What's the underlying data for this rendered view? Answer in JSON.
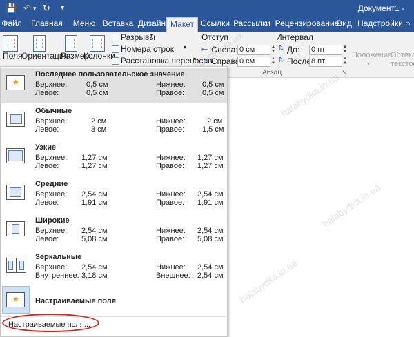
{
  "titlebar": {
    "title": "Документ1 -"
  },
  "tabs": [
    "Файл",
    "Главная",
    "Меню",
    "Вставка",
    "Дизайн",
    "Макет",
    "Ссылки",
    "Рассылки",
    "Рецензирование",
    "Вид",
    "Надстройки"
  ],
  "active_tab": "Макет",
  "ribbon": {
    "margins_label": "Поля",
    "orientation_label": "Ориентация",
    "size_label": "Размер",
    "columns_label": "Колонки",
    "breaks_label": "Разрывы",
    "line_numbers_label": "Номера строк",
    "hyphenation_label": "Расстановка переносов",
    "indent_header": "Отступ",
    "indent_left_label": "Слева:",
    "indent_left_value": "0 см",
    "indent_right_label": "Справа:",
    "indent_right_value": "0 см",
    "spacing_header": "Интервал",
    "spacing_before_label": "До:",
    "spacing_before_value": "0 пт",
    "spacing_after_label": "После:",
    "spacing_after_value": "8 пт",
    "paragraph_group": "Абзац",
    "position_label": "Положение",
    "wrap_label": "Обтекание текстом"
  },
  "presets": [
    {
      "title": "Последнее пользовательское значение",
      "top_label": "Верхнее:",
      "top": "0,5 см",
      "left_label": "Левое:",
      "left": "0,5 см",
      "bottom_label": "Нижнее:",
      "bottom": "0,5 см",
      "right_label": "Правое:",
      "right": "0,5 см"
    },
    {
      "title": "Обычные",
      "top_label": "Верхнее:",
      "top": "2 см",
      "left_label": "Левое:",
      "left": "3 см",
      "bottom_label": "Нижнее:",
      "bottom": "2 см",
      "right_label": "Правое:",
      "right": "1,5 см"
    },
    {
      "title": "Узкие",
      "top_label": "Верхнее:",
      "top": "1,27 см",
      "left_label": "Левое:",
      "left": "1,27 см",
      "bottom_label": "Нижнее:",
      "bottom": "1,27 см",
      "right_label": "Правое:",
      "right": "1,27 см"
    },
    {
      "title": "Средние",
      "top_label": "Верхнее:",
      "top": "2,54 см",
      "left_label": "Левое:",
      "left": "1,91 см",
      "bottom_label": "Нижнее:",
      "bottom": "2,54 см",
      "right_label": "Правое:",
      "right": "1,91 см"
    },
    {
      "title": "Широкие",
      "top_label": "Верхнее:",
      "top": "2,54 см",
      "left_label": "Левое:",
      "left": "5,08 см",
      "bottom_label": "Нижнее:",
      "bottom": "2,54 см",
      "right_label": "Правое:",
      "right": "5,08 см"
    },
    {
      "title": "Зеркальные",
      "top_label": "Верхнее:",
      "top": "2,54 см",
      "left_label": "Внутреннее:",
      "left": "3,18 см",
      "bottom_label": "Нижнее:",
      "bottom": "2,54 см",
      "right_label": "Внешнее:",
      "right": "2,54 см"
    }
  ],
  "custom": {
    "title": "Настраиваемые поля",
    "link": "Настраиваемые поля..."
  },
  "watermark": "halabydka.in.ua",
  "colors": {
    "accent": "#2b579a",
    "highlight_oval": "#e0201b"
  }
}
